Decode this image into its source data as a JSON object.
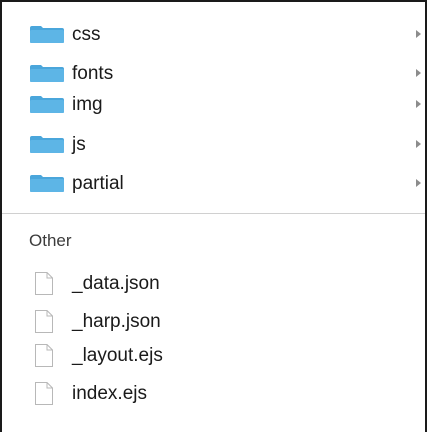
{
  "folders": [
    {
      "name": "css",
      "icon": "folder-icon"
    },
    {
      "name": "fonts",
      "icon": "folder-icon"
    },
    {
      "name": "img",
      "icon": "folder-icon"
    },
    {
      "name": "js",
      "icon": "folder-icon"
    },
    {
      "name": "partial",
      "icon": "folder-icon"
    }
  ],
  "other_section": {
    "title": "Other"
  },
  "files": [
    {
      "name": "_data.json",
      "icon": "file-icon"
    },
    {
      "name": "_harp.json",
      "icon": "file-icon"
    },
    {
      "name": "_layout.ejs",
      "icon": "file-icon"
    },
    {
      "name": "index.ejs",
      "icon": "file-icon"
    }
  ],
  "colors": {
    "folder": "#5db5e6",
    "folder_tab": "#4aa6db",
    "file_outline": "#b8b8b8",
    "chevron": "#8c8c8c"
  }
}
